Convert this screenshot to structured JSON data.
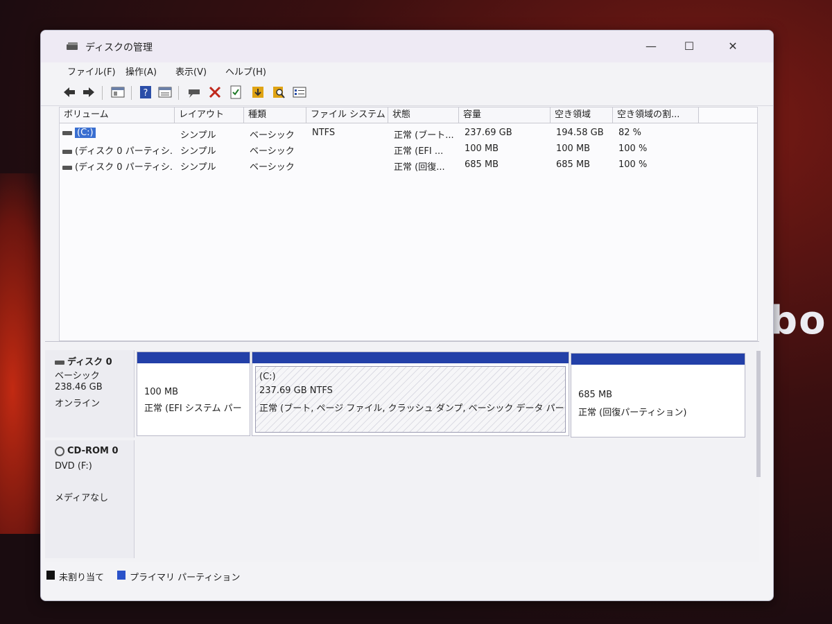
{
  "window": {
    "title": "ディスクの管理",
    "minimize": "—",
    "maximize": "☐",
    "close": "✕"
  },
  "menu": [
    "ファイル(F)",
    "操作(A)",
    "表示(V)",
    "ヘルプ(H)"
  ],
  "toolbar_icons": [
    "back-icon",
    "forward-icon",
    "view-icon",
    "help-icon",
    "properties-icon",
    "connect-icon",
    "delete-icon",
    "check-icon",
    "import-icon",
    "search-icon",
    "settings-list-icon"
  ],
  "columns": [
    "ボリューム",
    "レイアウト",
    "種類",
    "ファイル システム",
    "状態",
    "容量",
    "空き領域",
    "空き領域の割..."
  ],
  "volumes": [
    {
      "name": "(C:)",
      "layout": "シンプル",
      "type": "ベーシック",
      "fs": "NTFS",
      "status": "正常 (ブート...",
      "capacity": "237.69 GB",
      "free": "194.58 GB",
      "pct": "82 %"
    },
    {
      "name": "(ディスク 0 パーティシ...",
      "layout": "シンプル",
      "type": "ベーシック",
      "fs": "",
      "status": "正常 (EFI ...",
      "capacity": "100 MB",
      "free": "100 MB",
      "pct": "100 %"
    },
    {
      "name": "(ディスク 0 パーティシ...",
      "layout": "シンプル",
      "type": "ベーシック",
      "fs": "",
      "status": "正常 (回復...",
      "capacity": "685 MB",
      "free": "685 MB",
      "pct": "100 %"
    }
  ],
  "disk0": {
    "name": "ディスク 0",
    "type": "ベーシック",
    "size": "238.46 GB",
    "state": "オンライン",
    "partitions": [
      {
        "line1": "100 MB",
        "line2": "正常 (EFI システム パー"
      },
      {
        "label": "(C:)",
        "line1": "237.69 GB NTFS",
        "line2": "正常 (ブート, ページ ファイル, クラッシュ ダンプ, ベーシック データ パーテ"
      },
      {
        "line1": "685 MB",
        "line2": "正常 (回復パーティション)"
      }
    ]
  },
  "cdrom0": {
    "name": "CD-ROM 0",
    "drive": "DVD (F:)",
    "media": "メディアなし"
  },
  "legend": {
    "unallocated": "未割り当て",
    "primary": "プライマリ パーティション"
  },
  "background_text": "bo",
  "colors": {
    "partition_bar": "#2340a8",
    "unallocated": "#111111",
    "primary": "#2a52c9",
    "selection": "#3a6fd1"
  }
}
